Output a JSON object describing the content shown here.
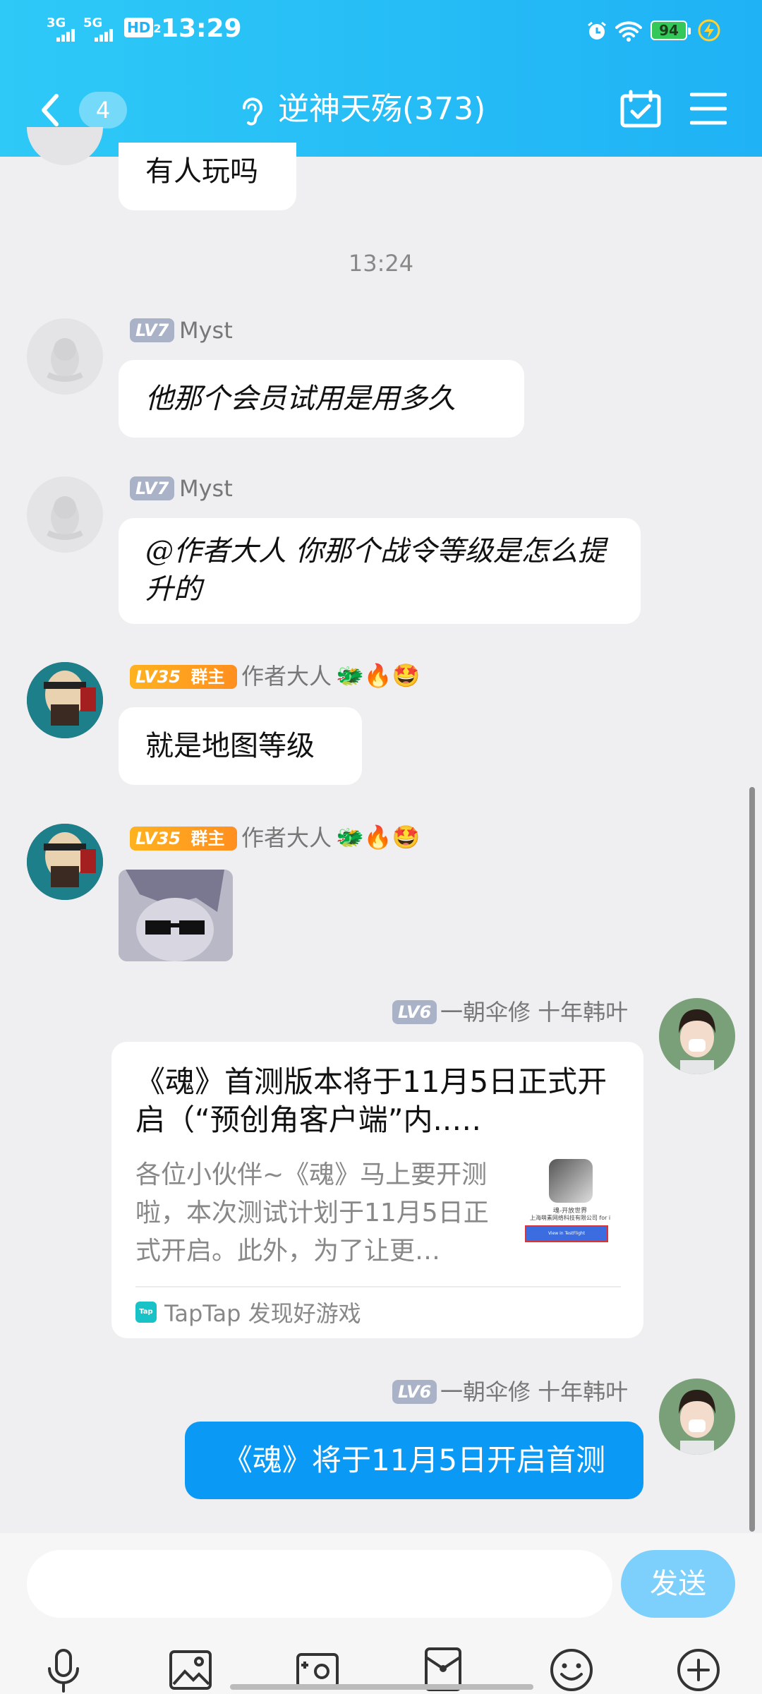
{
  "status_bar": {
    "signal_1": "3G",
    "signal_2": "5G",
    "hd": "HD",
    "hd_sub": "2",
    "time": "13:29",
    "battery": "94"
  },
  "header": {
    "back_count": "4",
    "title": "逆神天殇(373)"
  },
  "messages": {
    "m0": {
      "text": "有人玩吗"
    },
    "timestamp": "13:24",
    "m1": {
      "level": "LV7",
      "name": "Myst",
      "text": "他那个会员试用是用多久"
    },
    "m2": {
      "level": "LV7",
      "name": "Myst",
      "text": "@作者大人 你那个战令等级是怎么提升的"
    },
    "m3": {
      "level": "LV35",
      "role": "群主",
      "name": "作者大人",
      "text": "就是地图等级"
    },
    "m4": {
      "level": "LV35",
      "role": "群主",
      "name": "作者大人"
    },
    "m5": {
      "level": "LV6",
      "name": "一朝伞修 十年韩叶",
      "card_title": "《魂》首测版本将于11月5日正式开启（“预创角客户端”内..…",
      "card_desc": "各位小伙伴~《魂》马上要开测啦，本次测试计划于11月5日正式开启。此外，为了让更…",
      "thumb_line1": "魂-开放世界",
      "thumb_line2": "上海萌素网络科技有限公司 for i",
      "thumb_btn": "View in TestFlight",
      "source_badge": "Tap",
      "source": "TapTap 发现好游戏"
    },
    "m6": {
      "level": "LV6",
      "name": "一朝伞修 十年韩叶",
      "text": "《魂》将于11月5日开启首测"
    }
  },
  "input": {
    "placeholder": "",
    "send_label": "发送"
  },
  "colors": {
    "header_blue": "#1fb2f5",
    "self_bubble": "#0a99f5",
    "send_button": "#7dd0fb",
    "owner_badge": "#ff9c1f"
  },
  "icons": [
    "back-icon",
    "ear-icon",
    "calendar-check-icon",
    "menu-icon",
    "microphone-icon",
    "image-icon",
    "camera-icon",
    "red-packet-icon",
    "emoji-icon",
    "plus-icon",
    "qq-penguin-icon",
    "alarm-icon",
    "wifi-icon",
    "charging-icon"
  ]
}
